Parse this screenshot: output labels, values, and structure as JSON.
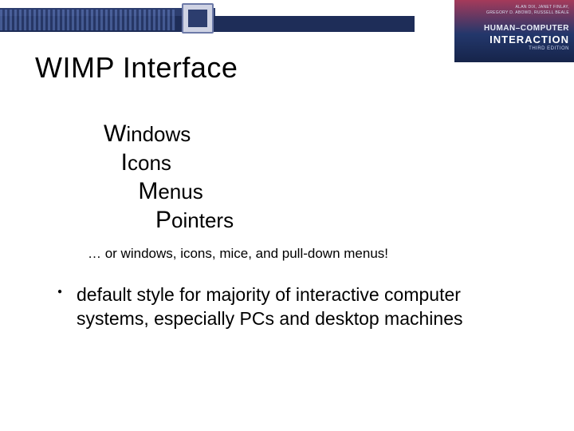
{
  "book": {
    "authors_line1": "ALAN DIX, JANET FINLAY,",
    "authors_line2": "GREGORY D. ABOWD, RUSSELL BEALE",
    "title_line1": "HUMAN–COMPUTER",
    "title_line2": "INTERACTION",
    "edition": "THIRD EDITION"
  },
  "title": "WIMP Interface",
  "acronym": {
    "w": {
      "cap": "W",
      "rest": "indows",
      "pad": ""
    },
    "i": {
      "cap": "I",
      "rest": "cons",
      "pad": "   "
    },
    "m": {
      "cap": "M",
      "rest": "enus",
      "pad": "      "
    },
    "p": {
      "cap": "P",
      "rest": "ointers",
      "pad": "         "
    }
  },
  "subline": "… or windows, icons, mice, and pull-down menus!",
  "bullet_mark": "●",
  "bullet": "default style for majority of interactive computer systems, especially PCs and desktop machines"
}
